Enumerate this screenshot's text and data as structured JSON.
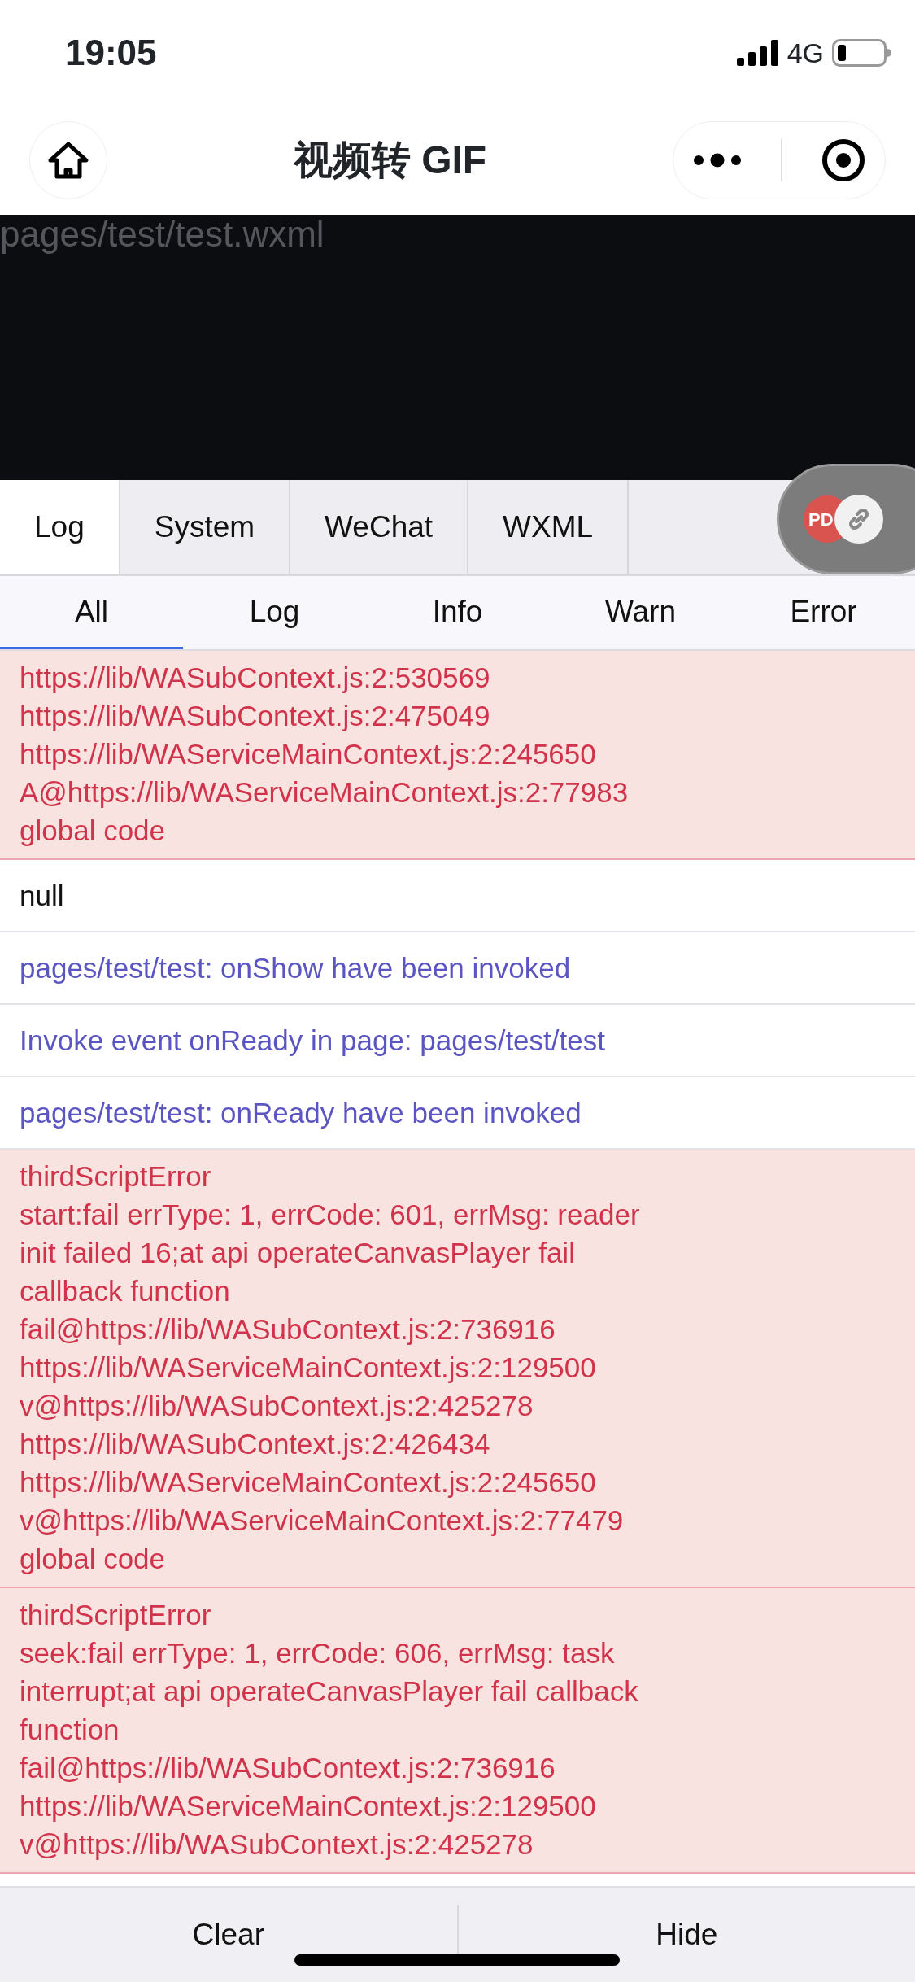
{
  "status_bar": {
    "time": "19:05",
    "network": "4G"
  },
  "nav_bar": {
    "title": "视频转 GIF"
  },
  "preview": {
    "text": "pages/test/test.wxml"
  },
  "tabs": [
    {
      "label": "Log",
      "selected": true
    },
    {
      "label": "System",
      "selected": false
    },
    {
      "label": "WeChat",
      "selected": false
    },
    {
      "label": "WXML",
      "selected": false
    }
  ],
  "floating_button": {
    "label": "PD"
  },
  "filters": [
    {
      "label": "All",
      "selected": true
    },
    {
      "label": "Log",
      "selected": false
    },
    {
      "label": "Info",
      "selected": false
    },
    {
      "label": "Warn",
      "selected": false
    },
    {
      "label": "Error",
      "selected": false
    }
  ],
  "logs": [
    {
      "kind": "error",
      "lines": [
        "https://lib/WASubContext.js:2:530569",
        "https://lib/WASubContext.js:2:475049",
        "https://lib/WAServiceMainContext.js:2:245650",
        "A@https://lib/WAServiceMainContext.js:2:77983",
        "global code"
      ]
    },
    {
      "kind": "plain",
      "lines": [
        "null"
      ]
    },
    {
      "kind": "info",
      "lines": [
        "pages/test/test: onShow have been invoked"
      ]
    },
    {
      "kind": "info",
      "lines": [
        "Invoke event onReady in page: pages/test/test"
      ]
    },
    {
      "kind": "info",
      "lines": [
        "pages/test/test: onReady have been invoked"
      ]
    },
    {
      "kind": "error",
      "lines": [
        "thirdScriptError",
        "start:fail errType: 1, errCode: 601, errMsg: reader",
        "init failed 16;at api operateCanvasPlayer fail",
        "callback function",
        "fail@https://lib/WASubContext.js:2:736916",
        "https://lib/WAServiceMainContext.js:2:129500",
        "v@https://lib/WASubContext.js:2:425278",
        "https://lib/WASubContext.js:2:426434",
        "https://lib/WAServiceMainContext.js:2:245650",
        "v@https://lib/WAServiceMainContext.js:2:77479",
        "global code"
      ]
    },
    {
      "kind": "error",
      "lines": [
        "thirdScriptError",
        "seek:fail errType: 1, errCode: 606, errMsg: task",
        "interrupt;at api operateCanvasPlayer fail callback",
        "function",
        "fail@https://lib/WASubContext.js:2:736916",
        "https://lib/WAServiceMainContext.js:2:129500",
        "v@https://lib/WASubContext.js:2:425278"
      ]
    }
  ],
  "footer_buttons": [
    "Clear",
    "Hide"
  ]
}
